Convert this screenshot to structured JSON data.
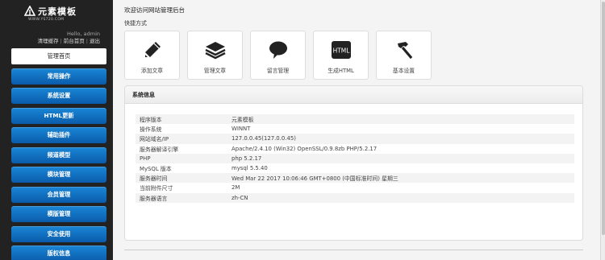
{
  "brand": {
    "name": "元素模板",
    "subtitle": "WWW.YS720.COM"
  },
  "user": {
    "greeting": "Hello, admin",
    "links": [
      "清理缓存",
      "前台首页",
      "退出"
    ]
  },
  "menu": [
    {
      "label": "管理首页",
      "active": true
    },
    {
      "label": "常用操作"
    },
    {
      "label": "系统设置"
    },
    {
      "label": "HTML更新"
    },
    {
      "label": "辅助插件"
    },
    {
      "label": "频道模型"
    },
    {
      "label": "模块管理"
    },
    {
      "label": "会员管理"
    },
    {
      "label": "模版管理"
    },
    {
      "label": "安全使用"
    },
    {
      "label": "版权信息"
    }
  ],
  "header": {
    "welcome": "欢迎访问网站管理后台",
    "quick_title": "快捷方式"
  },
  "quick_links": [
    {
      "label": "添加文章",
      "icon": "pencil-icon"
    },
    {
      "label": "管理文章",
      "icon": "stack-icon"
    },
    {
      "label": "留言管理",
      "icon": "speech-bubble-icon"
    },
    {
      "label": "生成HTML",
      "icon": "html-icon",
      "icon_text": "HTML"
    },
    {
      "label": "基本设置",
      "icon": "hammer-icon"
    }
  ],
  "system_info": {
    "title": "系统信息",
    "rows": [
      {
        "key": "程序版本",
        "value": "元素模板"
      },
      {
        "key": "操作系统",
        "value": "WINNT"
      },
      {
        "key": "网站域名/IP",
        "value": "127.0.0.45(127.0.0.45)"
      },
      {
        "key": "服务器解译引擎",
        "value": "Apache/2.4.10 (Win32) OpenSSL/0.9.8zb PHP/5.2.17"
      },
      {
        "key": "PHP",
        "value": "php 5.2.17"
      },
      {
        "key": "MySQL 版本",
        "value": "mysql 5.5.40"
      },
      {
        "key": "服务器时间",
        "value": "Wed Mar 22 2017 10:06:46 GMT+0800 (中国标准时间) 星期三"
      },
      {
        "key": "当前附件尺寸",
        "value": "2M"
      },
      {
        "key": "服务器语言",
        "value": "zh-CN"
      }
    ]
  },
  "colors": {
    "sidebar_bg": "#222222",
    "menu_blue": "#0a5cab",
    "page_bg": "#f4f4f4"
  }
}
